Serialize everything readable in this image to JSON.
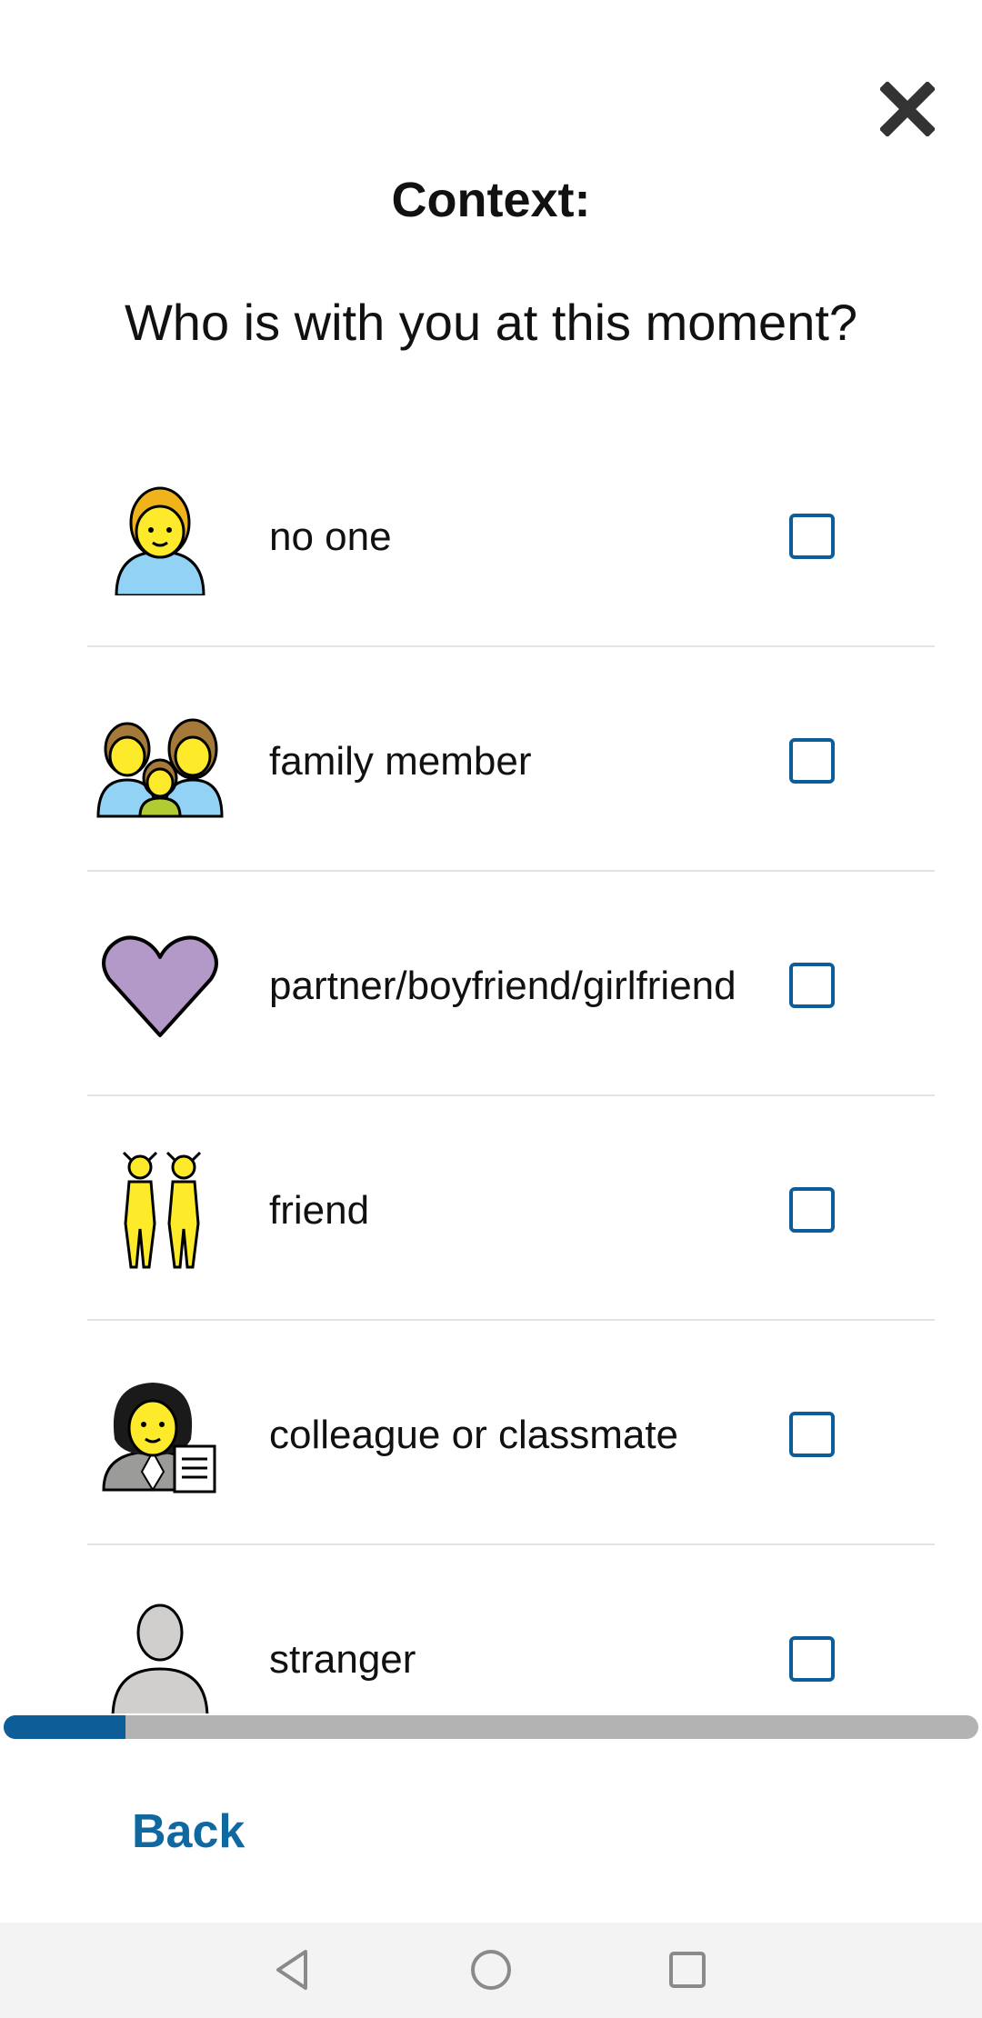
{
  "header": {
    "title": "Context:",
    "question": "Who is with you at this moment?"
  },
  "options": [
    {
      "label": "no one",
      "icon": "person-icon",
      "checked": false
    },
    {
      "label": "family member",
      "icon": "family-icon",
      "checked": false
    },
    {
      "label": "partner/boyfriend/girlfriend",
      "icon": "purple-heart-icon",
      "checked": false
    },
    {
      "label": "friend",
      "icon": "friends-icon",
      "checked": false
    },
    {
      "label": "colleague or classmate",
      "icon": "office-worker-icon",
      "checked": false
    },
    {
      "label": "stranger",
      "icon": "silhouette-icon",
      "checked": false
    }
  ],
  "progress": {
    "fraction": 0.125
  },
  "footer": {
    "back_label": "Back"
  },
  "colors": {
    "accent": "#0d5e98",
    "progress_track": "#b3b3b3",
    "heart": "#b399c8",
    "skin": "#fcea2b",
    "shirt": "#92d3f5"
  }
}
